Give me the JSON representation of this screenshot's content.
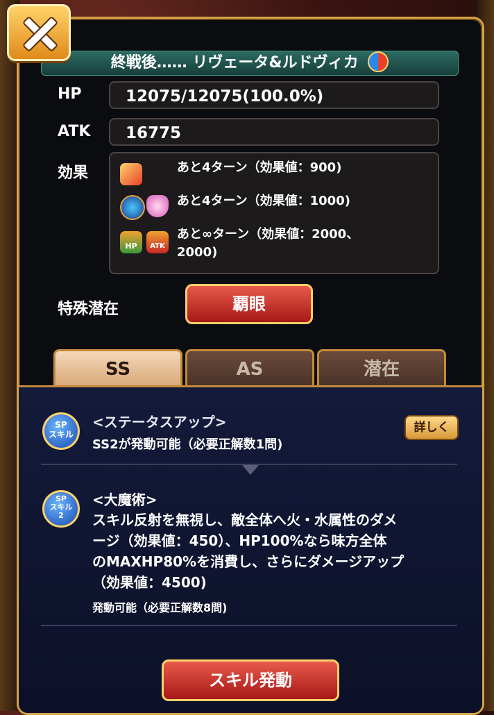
{
  "card": {
    "title": "終戦後…… リヴェータ&ルドヴィカ",
    "hp_label": "HP",
    "hp_value": "12075/12075(100.0%)",
    "atk_label": "ATK",
    "atk_value": "16775",
    "effects_label": "効果",
    "effects": [
      {
        "text": "あと4ターン（効果値：900)",
        "icons": [
          "attack-up-icon"
        ]
      },
      {
        "text": "あと4ターン（効果値：1000)",
        "icons": [
          "eye-icon",
          "shield-icon"
        ]
      },
      {
        "text": "あと∞ターン（効果値：2000、",
        "text2": "2000)",
        "icons": [
          "hp-up-icon",
          "atk-up-icon"
        ]
      }
    ],
    "special_potential_label": "特殊潜在",
    "special_potential_button": "覇眼"
  },
  "tabs": [
    {
      "label": "SS",
      "active": true
    },
    {
      "label": "AS",
      "active": false
    },
    {
      "label": "潜在",
      "active": false
    }
  ],
  "skills": [
    {
      "badge": "SP\nスキル",
      "name": "<ステータスアップ>",
      "desc": "SS2が発動可能（必要正解数1問)",
      "detail_button": "詳しく"
    },
    {
      "badge": "SP\nスキル\n2",
      "name": "<大魔術>",
      "desc_lines": [
        "スキル反射を無視し、敵全体へ火・水属性のダメ",
        "ージ（効果値：450）、HP100%なら味方全体",
        "のMAXHP80%を消費し、さらにダメージアップ",
        "（効果値：4500)"
      ],
      "sub": "発動可能（必要正解数8問)"
    }
  ],
  "activate_button": "スキル発動",
  "colors": {
    "accent_gold": "#d6a24a",
    "button_red": "#c82828",
    "skill_bg": "#141a3a"
  }
}
